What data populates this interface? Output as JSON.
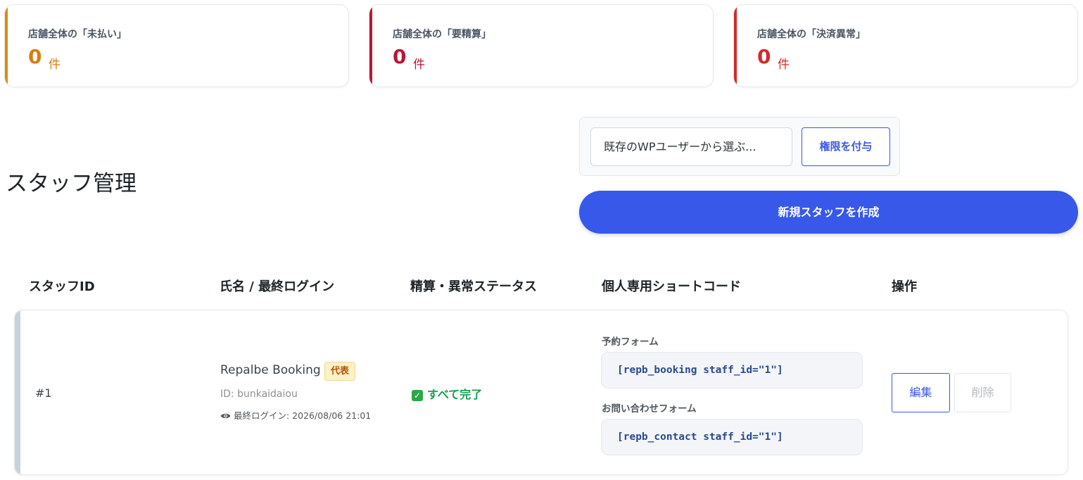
{
  "summary_cards": [
    {
      "label": "店舗全体の「未払い」",
      "value": "0",
      "unit": "件",
      "color": "#d97d0e"
    },
    {
      "label": "店舗全体の「要精算」",
      "value": "0",
      "unit": "件",
      "color": "#b81637"
    },
    {
      "label": "店舗全体の「決済異常」",
      "value": "0",
      "unit": "件",
      "color": "#d22a2a"
    }
  ],
  "page": {
    "title": "スタッフ管理"
  },
  "assign": {
    "select_value": "既存のWPユーザーから選ぶ...",
    "grant_label": "権限を付与"
  },
  "create_label": "新規スタッフを作成",
  "table": {
    "headers": [
      "スタッフID",
      "氏名 / 最終ログイン",
      "精算・異常ステータス",
      "個人専用ショートコード",
      "操作"
    ],
    "rows": [
      {
        "id": "#1",
        "name": "Repalbe Booking",
        "badge": "代表",
        "login_id": "ID: bunkaidaiou",
        "last_login": "最終ログイン: 2026/08/06 21:01",
        "status": "すべて完了",
        "booking_label": "予約フォーム",
        "booking_code": "[repb_booking staff_id=\"1\"]",
        "contact_label": "お問い合わせフォーム",
        "contact_code": "[repb_contact staff_id=\"1\"]",
        "edit_label": "編集",
        "delete_label": "削除"
      }
    ]
  },
  "colors": {
    "accent": "#3858e9",
    "success": "#15a04a"
  }
}
